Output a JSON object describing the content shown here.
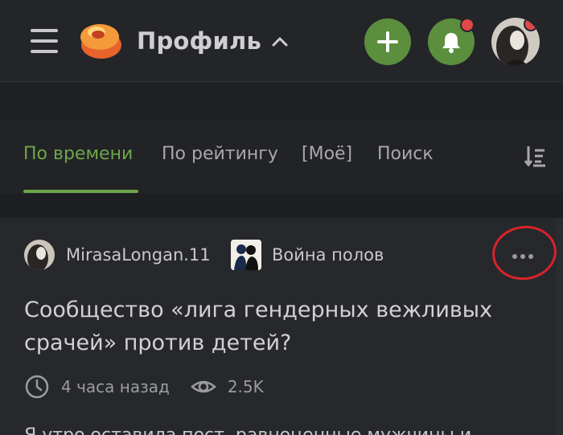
{
  "header": {
    "title": "Профиль",
    "plus_label": "+",
    "notifications_badge": true
  },
  "tabs": [
    {
      "label": "По времени",
      "active": true
    },
    {
      "label": "По рейтингу",
      "active": false
    },
    {
      "label": "[Моё]",
      "active": false
    },
    {
      "label": "Поиск",
      "active": false
    }
  ],
  "post": {
    "author": "MirasaLongan.11",
    "community": "Война полов",
    "title": "Сообщество «лига гендерных вежливых срачей» против детей?",
    "time": "4 часа назад",
    "views": "2.5K",
    "body": "Я утро оставила пост, равноценные мужчины и"
  },
  "colors": {
    "accent_green": "#6da64a",
    "button_green": "#5b8f3e",
    "badge_red": "#e04848",
    "annotation_red": "#d8232a",
    "background": "#222326"
  },
  "icons": [
    "menu-icon",
    "logo-icon",
    "chevron-up-icon",
    "plus-icon",
    "bell-icon",
    "sort-icon",
    "more-icon",
    "clock-icon",
    "eye-icon"
  ]
}
